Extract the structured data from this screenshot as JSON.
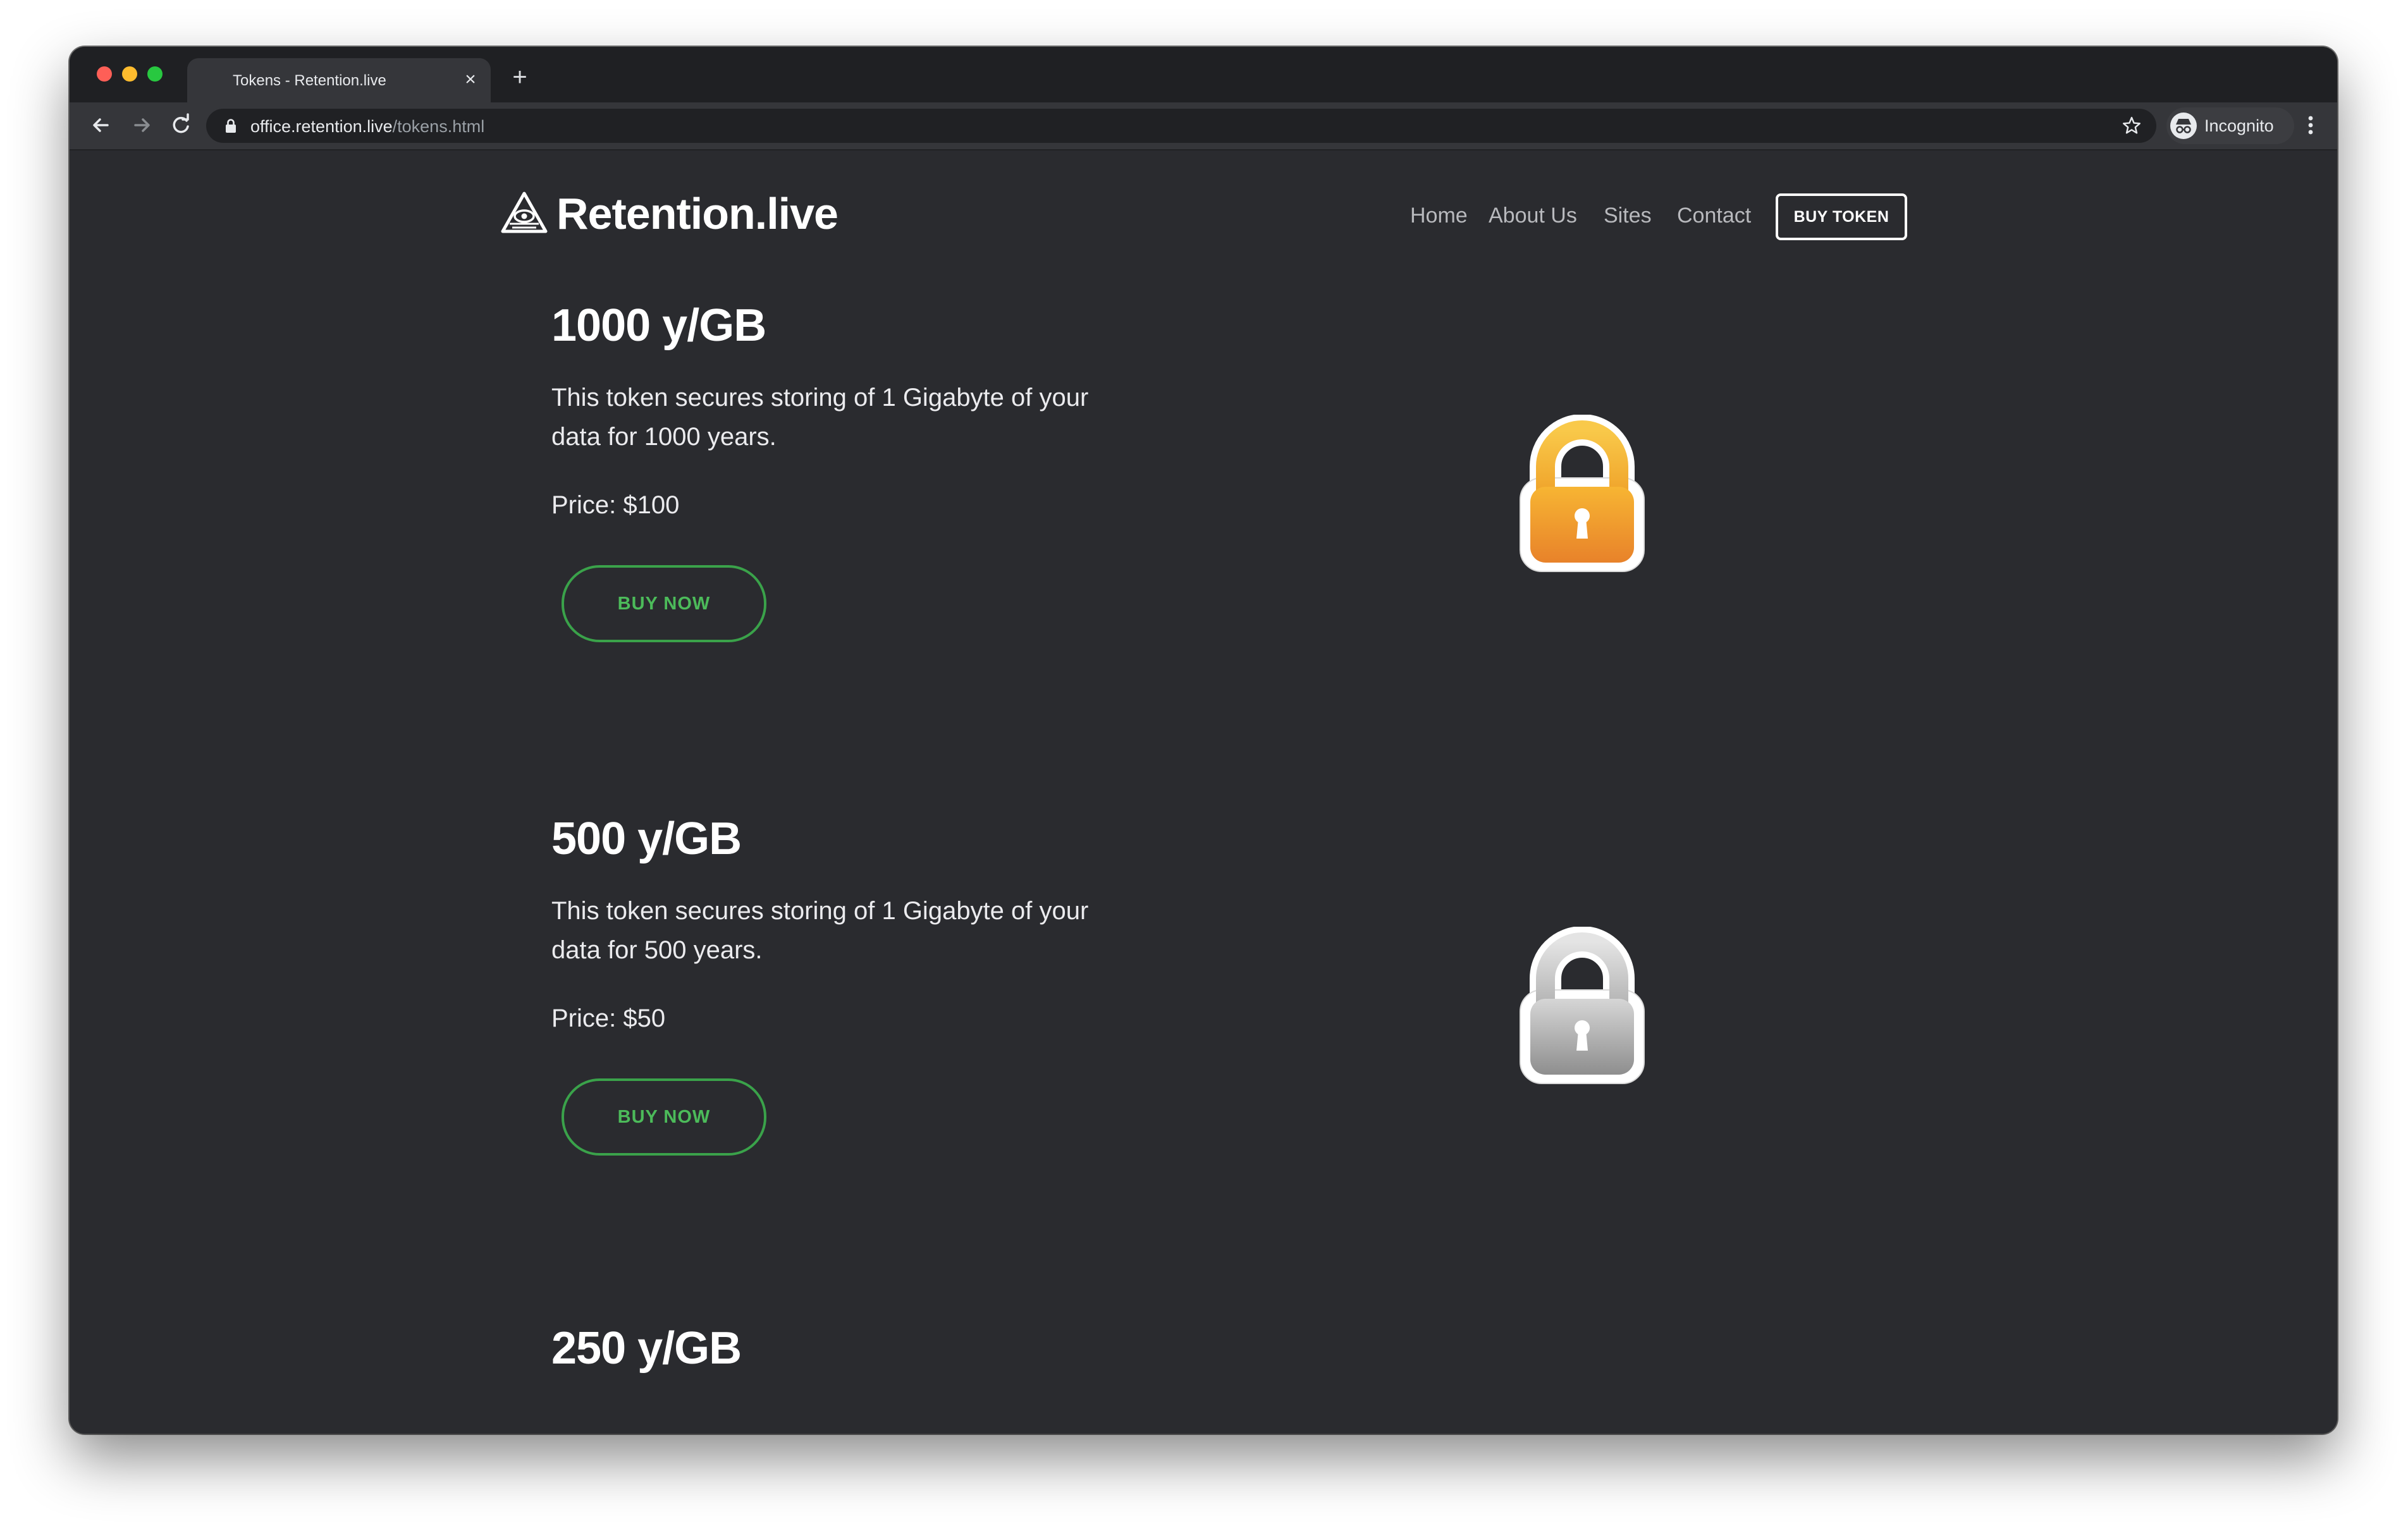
{
  "browser": {
    "tab_title": "Tokens - Retention.live",
    "url_host": "office.retention.live",
    "url_path": "/tokens.html",
    "profile_label": "Incognito",
    "close_glyph": "×",
    "new_tab_glyph": "+"
  },
  "site": {
    "brand": "Retention.live",
    "nav": [
      "Home",
      "About Us",
      "Sites",
      "Contact"
    ],
    "cta": "BUY TOKEN"
  },
  "tokens": [
    {
      "title": "1000 y/GB",
      "description": "This token secures storing of 1 Gigabyte of your data for 1000 years.",
      "price": "Price: $100",
      "button": "BUY NOW",
      "lock_color": "gold"
    },
    {
      "title": "500 y/GB",
      "description": "This token secures storing of 1 Gigabyte of your data for 500 years.",
      "price": "Price: $50",
      "button": "BUY NOW",
      "lock_color": "silver"
    },
    {
      "title": "250 y/GB"
    }
  ],
  "colors": {
    "page_background": "#2a2b2f",
    "accent_green": "#3aa24a",
    "lock_gold": "#f0a52c",
    "lock_silver": "#b8b8b8"
  }
}
